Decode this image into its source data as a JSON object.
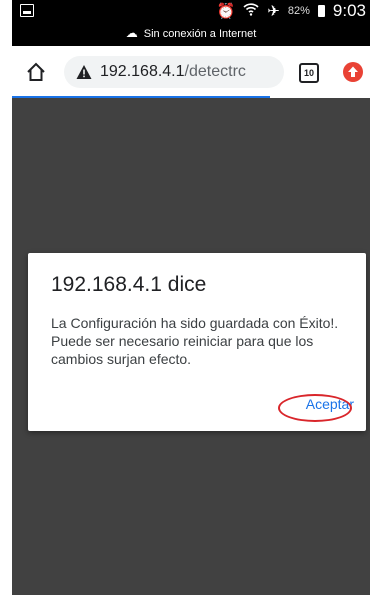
{
  "statusbar": {
    "battery_percent": "82%",
    "time": "9:03",
    "offline_notice": "Sin conexión a Internet"
  },
  "toolbar": {
    "url_host": "192.168.4.1",
    "url_path": "/detectrc",
    "tab_count": "10"
  },
  "dialog": {
    "title": "192.168.4.1 dice",
    "message": "La Configuración ha sido guardada con Éxito!. Puede ser necesario reiniciar para que los cambios surjan efecto.",
    "accept_label": "Aceptar"
  },
  "colors": {
    "page_background": "#414141",
    "accent": "#1a73e8",
    "highlight_circle": "#d9262b"
  }
}
